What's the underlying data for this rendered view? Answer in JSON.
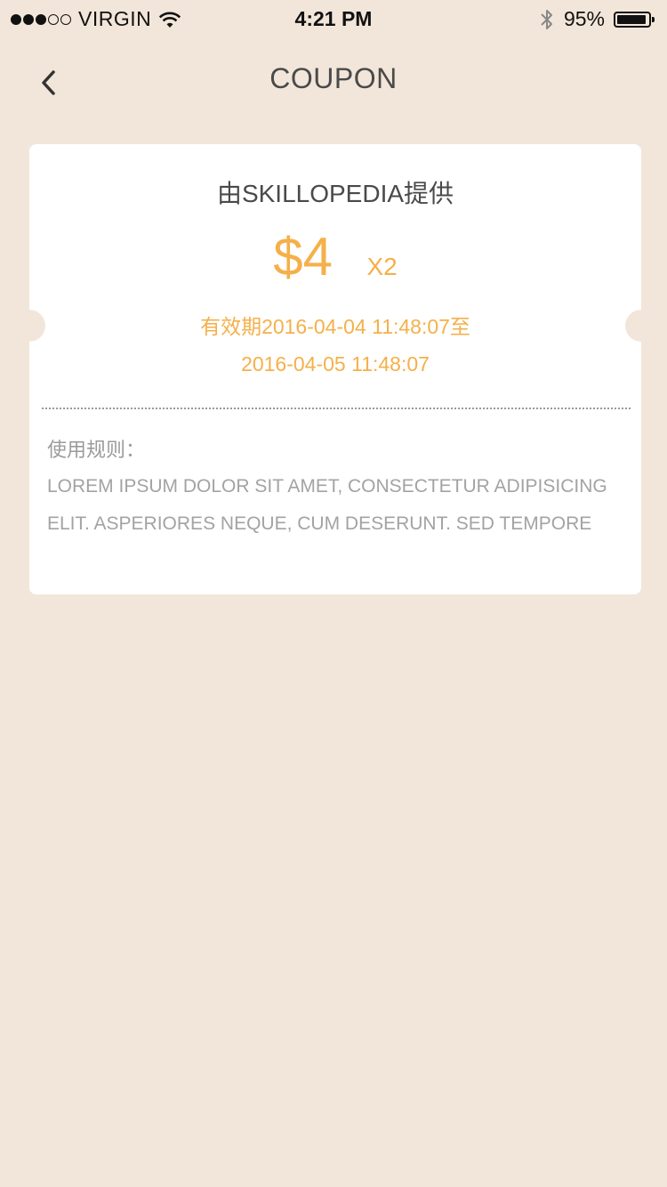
{
  "status_bar": {
    "signal_filled": 3,
    "signal_total": 5,
    "carrier": "VIRGIN",
    "time": "4:21 PM",
    "battery_percent": "95%",
    "battery_level": 0.95
  },
  "nav": {
    "title": "COUPON",
    "back_icon": "chevron-left-icon"
  },
  "coupon": {
    "provider": "由SKILLOPEDIA提供",
    "amount": "$4",
    "quantity": "X2",
    "validity_line1": "有效期2016-04-04 11:48:07至",
    "validity_line2": "2016-04-05 11:48:07",
    "rules_title": "使用规则：",
    "rules_line1": "LOREM IPSUM DOLOR SIT AMET, CONSECTETUR ADIPISICING",
    "rules_line2": "ELIT. ASPERIORES NEQUE, CUM DESERUNT. SED TEMPORE"
  },
  "colors": {
    "background": "#f2e6da",
    "accent": "#f5b04a",
    "card": "#ffffff",
    "title_text": "#4a4a4a",
    "muted_text": "#a3a3a3"
  }
}
